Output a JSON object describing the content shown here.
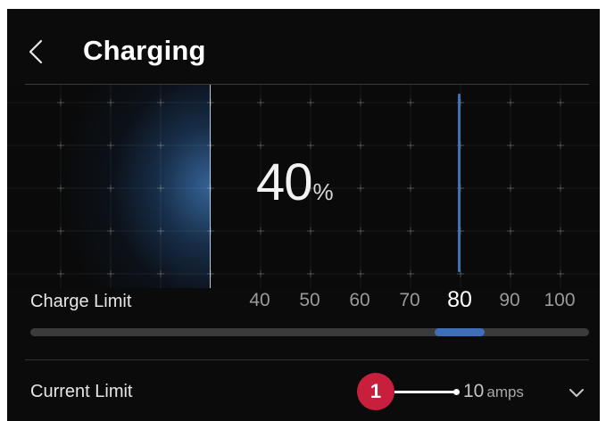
{
  "header": {
    "title": "Charging"
  },
  "battery": {
    "level_value": "40",
    "level_unit": "%",
    "level_percent": 40,
    "charge_limit_percent": 80
  },
  "charge_limit": {
    "label": "Charge Limit",
    "options": [
      "40",
      "50",
      "60",
      "70",
      "80",
      "90",
      "100"
    ],
    "selected": "80"
  },
  "current_limit": {
    "label": "Current Limit",
    "value": "10",
    "unit": "amps"
  },
  "callout": {
    "number": "1"
  },
  "colors": {
    "accent": "#3e6fb7",
    "callout": "#c8203c",
    "background": "#0b0b0b"
  },
  "icons": {
    "back": "chevron-left-icon",
    "dropdown": "chevron-down-icon"
  }
}
